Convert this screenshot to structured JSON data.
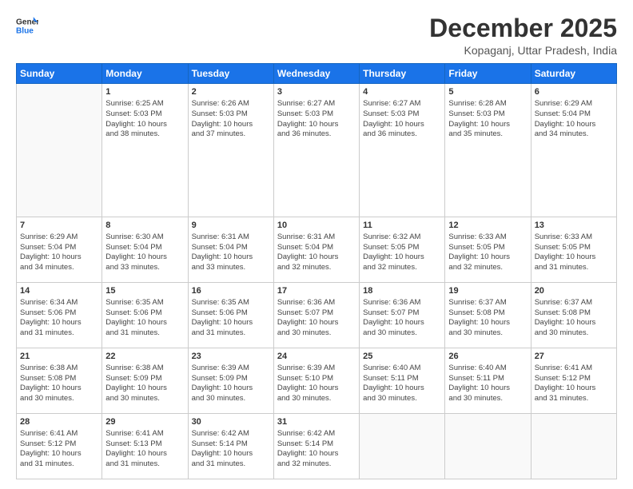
{
  "header": {
    "logo_general": "General",
    "logo_blue": "Blue",
    "month_title": "December 2025",
    "subtitle": "Kopaganj, Uttar Pradesh, India"
  },
  "columns": [
    "Sunday",
    "Monday",
    "Tuesday",
    "Wednesday",
    "Thursday",
    "Friday",
    "Saturday"
  ],
  "weeks": [
    [
      {
        "day": "",
        "info": ""
      },
      {
        "day": "1",
        "info": "Sunrise: 6:25 AM\nSunset: 5:03 PM\nDaylight: 10 hours\nand 38 minutes."
      },
      {
        "day": "2",
        "info": "Sunrise: 6:26 AM\nSunset: 5:03 PM\nDaylight: 10 hours\nand 37 minutes."
      },
      {
        "day": "3",
        "info": "Sunrise: 6:27 AM\nSunset: 5:03 PM\nDaylight: 10 hours\nand 36 minutes."
      },
      {
        "day": "4",
        "info": "Sunrise: 6:27 AM\nSunset: 5:03 PM\nDaylight: 10 hours\nand 36 minutes."
      },
      {
        "day": "5",
        "info": "Sunrise: 6:28 AM\nSunset: 5:03 PM\nDaylight: 10 hours\nand 35 minutes."
      },
      {
        "day": "6",
        "info": "Sunrise: 6:29 AM\nSunset: 5:04 PM\nDaylight: 10 hours\nand 34 minutes."
      }
    ],
    [
      {
        "day": "7",
        "info": "Sunrise: 6:29 AM\nSunset: 5:04 PM\nDaylight: 10 hours\nand 34 minutes."
      },
      {
        "day": "8",
        "info": "Sunrise: 6:30 AM\nSunset: 5:04 PM\nDaylight: 10 hours\nand 33 minutes."
      },
      {
        "day": "9",
        "info": "Sunrise: 6:31 AM\nSunset: 5:04 PM\nDaylight: 10 hours\nand 33 minutes."
      },
      {
        "day": "10",
        "info": "Sunrise: 6:31 AM\nSunset: 5:04 PM\nDaylight: 10 hours\nand 32 minutes."
      },
      {
        "day": "11",
        "info": "Sunrise: 6:32 AM\nSunset: 5:05 PM\nDaylight: 10 hours\nand 32 minutes."
      },
      {
        "day": "12",
        "info": "Sunrise: 6:33 AM\nSunset: 5:05 PM\nDaylight: 10 hours\nand 32 minutes."
      },
      {
        "day": "13",
        "info": "Sunrise: 6:33 AM\nSunset: 5:05 PM\nDaylight: 10 hours\nand 31 minutes."
      }
    ],
    [
      {
        "day": "14",
        "info": "Sunrise: 6:34 AM\nSunset: 5:06 PM\nDaylight: 10 hours\nand 31 minutes."
      },
      {
        "day": "15",
        "info": "Sunrise: 6:35 AM\nSunset: 5:06 PM\nDaylight: 10 hours\nand 31 minutes."
      },
      {
        "day": "16",
        "info": "Sunrise: 6:35 AM\nSunset: 5:06 PM\nDaylight: 10 hours\nand 31 minutes."
      },
      {
        "day": "17",
        "info": "Sunrise: 6:36 AM\nSunset: 5:07 PM\nDaylight: 10 hours\nand 30 minutes."
      },
      {
        "day": "18",
        "info": "Sunrise: 6:36 AM\nSunset: 5:07 PM\nDaylight: 10 hours\nand 30 minutes."
      },
      {
        "day": "19",
        "info": "Sunrise: 6:37 AM\nSunset: 5:08 PM\nDaylight: 10 hours\nand 30 minutes."
      },
      {
        "day": "20",
        "info": "Sunrise: 6:37 AM\nSunset: 5:08 PM\nDaylight: 10 hours\nand 30 minutes."
      }
    ],
    [
      {
        "day": "21",
        "info": "Sunrise: 6:38 AM\nSunset: 5:08 PM\nDaylight: 10 hours\nand 30 minutes."
      },
      {
        "day": "22",
        "info": "Sunrise: 6:38 AM\nSunset: 5:09 PM\nDaylight: 10 hours\nand 30 minutes."
      },
      {
        "day": "23",
        "info": "Sunrise: 6:39 AM\nSunset: 5:09 PM\nDaylight: 10 hours\nand 30 minutes."
      },
      {
        "day": "24",
        "info": "Sunrise: 6:39 AM\nSunset: 5:10 PM\nDaylight: 10 hours\nand 30 minutes."
      },
      {
        "day": "25",
        "info": "Sunrise: 6:40 AM\nSunset: 5:11 PM\nDaylight: 10 hours\nand 30 minutes."
      },
      {
        "day": "26",
        "info": "Sunrise: 6:40 AM\nSunset: 5:11 PM\nDaylight: 10 hours\nand 30 minutes."
      },
      {
        "day": "27",
        "info": "Sunrise: 6:41 AM\nSunset: 5:12 PM\nDaylight: 10 hours\nand 31 minutes."
      }
    ],
    [
      {
        "day": "28",
        "info": "Sunrise: 6:41 AM\nSunset: 5:12 PM\nDaylight: 10 hours\nand 31 minutes."
      },
      {
        "day": "29",
        "info": "Sunrise: 6:41 AM\nSunset: 5:13 PM\nDaylight: 10 hours\nand 31 minutes."
      },
      {
        "day": "30",
        "info": "Sunrise: 6:42 AM\nSunset: 5:14 PM\nDaylight: 10 hours\nand 31 minutes."
      },
      {
        "day": "31",
        "info": "Sunrise: 6:42 AM\nSunset: 5:14 PM\nDaylight: 10 hours\nand 32 minutes."
      },
      {
        "day": "",
        "info": ""
      },
      {
        "day": "",
        "info": ""
      },
      {
        "day": "",
        "info": ""
      }
    ]
  ]
}
